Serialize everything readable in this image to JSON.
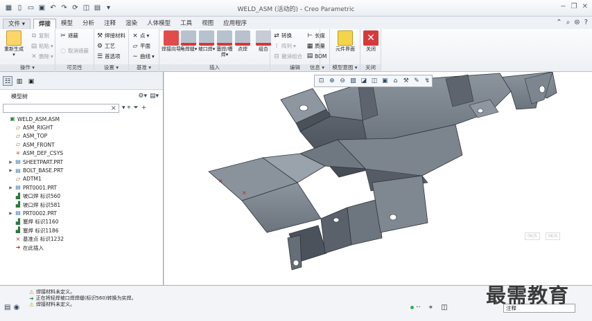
{
  "window": {
    "title": "WELD_ASM (活动的) - Creo Parametric"
  },
  "menu_tabs": [
    "文件",
    "焊接",
    "模型",
    "分析",
    "注释",
    "渲染",
    "人体模型",
    "工具",
    "视图",
    "应用程序"
  ],
  "ribbon": {
    "groups": {
      "operations": "操作",
      "visibility": "可见性",
      "settings": "设置",
      "datum": "基准",
      "insert": "插入",
      "edit": "编辑",
      "info": "信息",
      "model_intent": "模型意图",
      "close": "关闭"
    },
    "buttons": {
      "regenerate": "重新生成",
      "copy": "复制",
      "paste": "粘贴",
      "delete": "删除",
      "hide": "遮蔽",
      "unhide": "取消遮蔽",
      "weld_material": "焊接材料",
      "process": "工艺",
      "options": "首选项",
      "point": "点",
      "plane": "平面",
      "curve": "曲线",
      "weld_guide": "焊接向导",
      "fillet_weld": "角焊缝",
      "groove_weld": "坡口焊",
      "plug_weld": "塞焊/槽焊",
      "spot_weld": "点焊",
      "combine": "组合",
      "convert": "转换",
      "pattern": "阵列",
      "ungroup": "撤消组合",
      "length": "长度",
      "mass": "质量",
      "bom": "BOM",
      "component_interface": "元件界面",
      "close_btn": "关闭"
    }
  },
  "model_tree": {
    "title": "模型树",
    "items": [
      {
        "label": "WELD_ASM.ASM",
        "icon": "assembly-icon",
        "expand": ""
      },
      {
        "label": "ASM_RIGHT",
        "icon": "datum-plane-icon",
        "expand": ""
      },
      {
        "label": "ASM_TOP",
        "icon": "datum-plane-icon",
        "expand": ""
      },
      {
        "label": "ASM_FRONT",
        "icon": "datum-plane-icon",
        "expand": ""
      },
      {
        "label": "ASM_DEF_CSYS",
        "icon": "csys-icon",
        "expand": ""
      },
      {
        "label": "SHEETPART.PRT",
        "icon": "part-icon",
        "expand": "▶"
      },
      {
        "label": "BOLT_BASE.PRT",
        "icon": "part-icon",
        "expand": "▶"
      },
      {
        "label": "ADTM1",
        "icon": "datum-plane-icon",
        "expand": ""
      },
      {
        "label": "PRT0001.PRT",
        "icon": "part-icon",
        "expand": "▶"
      },
      {
        "label": "坡口焊 标识560",
        "icon": "weld-icon",
        "expand": ""
      },
      {
        "label": "坡口焊 标识581",
        "icon": "weld-icon",
        "expand": ""
      },
      {
        "label": "PRT0002.PRT",
        "icon": "part-icon",
        "expand": "▶"
      },
      {
        "label": "塞焊 标识1160",
        "icon": "weld-icon",
        "expand": ""
      },
      {
        "label": "塞焊 标识1186",
        "icon": "weld-icon",
        "expand": ""
      },
      {
        "label": "基准点 标识1232",
        "icon": "datum-point-icon",
        "expand": ""
      },
      {
        "label": "在此插入",
        "icon": "insert-here-icon",
        "expand": ""
      }
    ]
  },
  "status": {
    "messages": [
      {
        "icon": "warning-icon",
        "text": "焊接材料未定义。"
      },
      {
        "icon": "info-icon",
        "text": "正在将轻焊坡口焊焊缝(标识560)转换为实焊。"
      },
      {
        "icon": "warning-icon",
        "text": "焊接材料未定义。"
      }
    ],
    "filter_value": "注释"
  },
  "viewport": {
    "ghost_labels": [
      "0K/S",
      "0K/S"
    ]
  },
  "watermark": "最需教育",
  "colors": {
    "model_fill": "#737b86",
    "model_dark": "#3f4650",
    "model_light": "#9aa2ac",
    "accent_tab": "#fafbfc"
  }
}
